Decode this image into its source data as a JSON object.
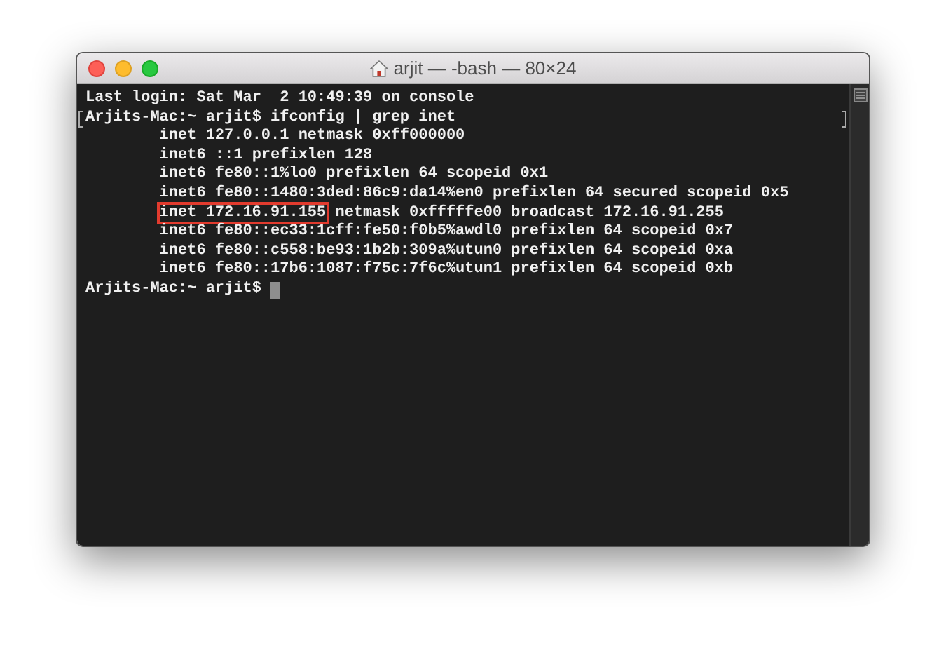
{
  "window": {
    "title": "arjit — -bash — 80×24"
  },
  "terminal": {
    "lines": [
      {
        "text": "Last login: Sat Mar  2 10:49:39 on console",
        "marked": false
      },
      {
        "text": "Arjits-Mac:~ arjit$ ifconfig | grep inet",
        "marked": true
      },
      {
        "text": "        inet 127.0.0.1 netmask 0xff000000",
        "marked": false
      },
      {
        "text": "        inet6 ::1 prefixlen 128",
        "marked": false
      },
      {
        "text": "        inet6 fe80::1%lo0 prefixlen 64 scopeid 0x1",
        "marked": false
      },
      {
        "text": "        inet6 fe80::1480:3ded:86c9:da14%en0 prefixlen 64 secured scopeid 0x5",
        "marked": false
      },
      {
        "highlight": "inet 172.16.91.155",
        "text": " netmask 0xfffffe00 broadcast 172.16.91.255",
        "marked": false
      },
      {
        "text": "        inet6 fe80::ec33:1cff:fe50:f0b5%awdl0 prefixlen 64 scopeid 0x7",
        "marked": false
      },
      {
        "text": "        inet6 fe80::c558:be93:1b2b:309a%utun0 prefixlen 64 scopeid 0xa",
        "marked": false
      },
      {
        "text": "        inet6 fe80::17b6:1087:f75c:7f6c%utun1 prefixlen 64 scopeid 0xb",
        "marked": false
      },
      {
        "text": "Arjits-Mac:~ arjit$ ",
        "marked": false,
        "cursor": true
      }
    ]
  }
}
